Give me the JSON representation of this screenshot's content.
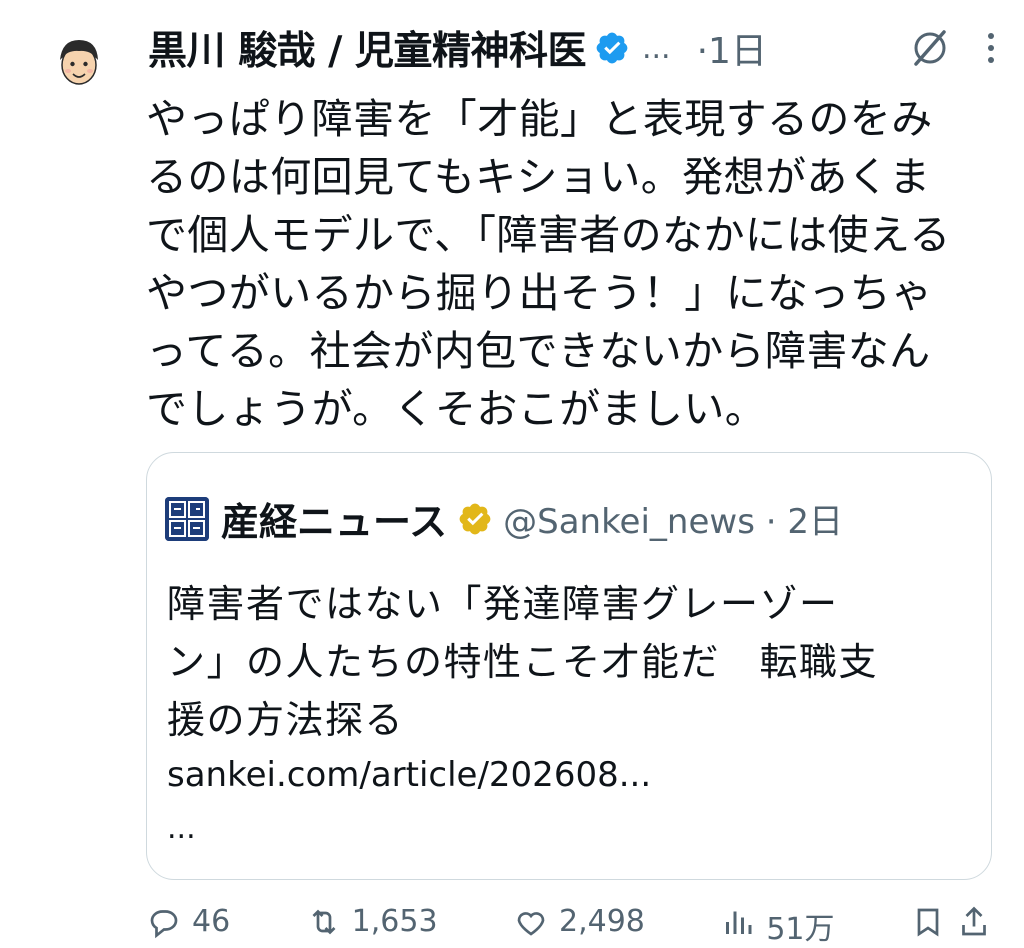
{
  "tweet": {
    "author_name": "黒川 駿哉 / 児童精神科医",
    "ellipsis": "...",
    "time": "·1日",
    "text_lines": [
      "やっぱり障害を「才能」と表現するのをみ",
      "るのは何回見てもキショい。発想があくま",
      "で個人モデルで、「障害者のなかには使える",
      "やつがいるから掘り出そう！」になっちゃ",
      "ってる。社会が内包できないから障害なん",
      "でしょうが。くそおこがましい。"
    ]
  },
  "quote": {
    "source_name": "産経ニュース",
    "handle_time": "@Sankei_news · 2日",
    "text_lines": [
      "障害者ではない「発達障害グレーゾー",
      "ン」の人たちの特性こそ才能だ　転職支",
      "援の方法探る"
    ],
    "link": "sankei.com/article/202608...",
    "more": "..."
  },
  "actions": {
    "reply_count": "46",
    "retweet_count": "1,653",
    "like_count": "2,498",
    "views_count": "51万"
  },
  "colors": {
    "verified_blue": "#1d9bf0",
    "gold_badge": "#e2b719",
    "secondary_text": "#536471",
    "border": "#cfd9de"
  },
  "icons": [
    "avatar-face",
    "verified-badge",
    "grok-icon",
    "more-vertical-icon",
    "sankei-logo",
    "gold-verified-badge",
    "reply-icon",
    "retweet-icon",
    "like-icon",
    "views-icon",
    "bookmark-icon",
    "share-icon"
  ]
}
